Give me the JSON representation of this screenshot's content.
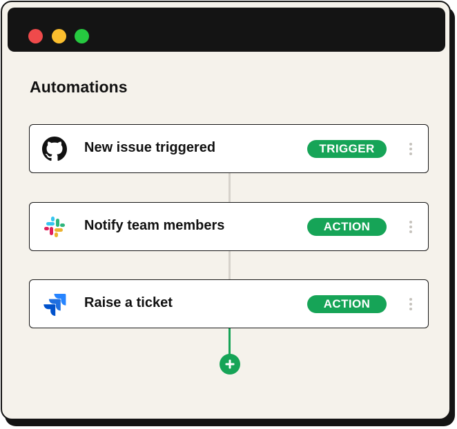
{
  "window": {
    "controls": [
      {
        "name": "close",
        "color": "#ef4a4b"
      },
      {
        "name": "minimize",
        "color": "#fbbe2e"
      },
      {
        "name": "maximize",
        "color": "#26c940"
      }
    ]
  },
  "page": {
    "title": "Automations"
  },
  "steps": [
    {
      "icon": "github-icon",
      "label": "New issue triggered",
      "badge": "TRIGGER"
    },
    {
      "icon": "slack-icon",
      "label": "Notify team members",
      "badge": "ACTION"
    },
    {
      "icon": "jira-icon",
      "label": "Raise a ticket",
      "badge": "ACTION"
    }
  ],
  "colors": {
    "accent": "#16a457",
    "background": "#f5f2eb",
    "titlebar": "#141414"
  }
}
